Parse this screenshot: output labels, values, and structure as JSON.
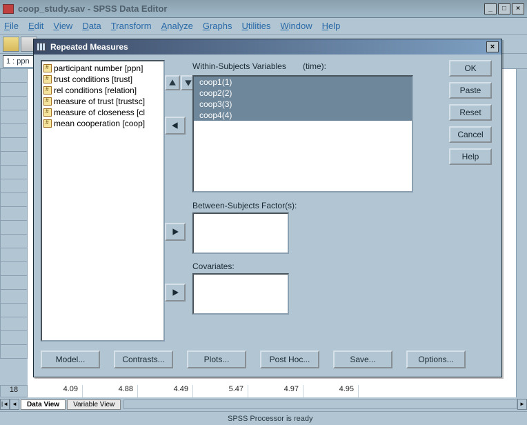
{
  "window": {
    "title": "coop_study.sav - SPSS Data Editor",
    "min_glyph": "_",
    "max_glyph": "□",
    "close_glyph": "×"
  },
  "menu": {
    "file": "File",
    "edit": "Edit",
    "view": "View",
    "data": "Data",
    "transform": "Transform",
    "analyze": "Analyze",
    "graphs": "Graphs",
    "utilities": "Utilities",
    "window": "Window",
    "help": "Help"
  },
  "cellbar": {
    "address": "1 : ppn"
  },
  "grid": {
    "row_number": "18",
    "cells": [
      "4.09",
      "4.88",
      "4.49",
      "5.47",
      "4.97",
      "4.95"
    ]
  },
  "tabs": {
    "data_view": "Data View",
    "variable_view": "Variable View"
  },
  "statusbar": {
    "text": "SPSS Processor  is ready"
  },
  "dialog": {
    "title": "Repeated Measures",
    "close_glyph": "×",
    "labels": {
      "within": "Within-Subjects Variables",
      "factor": "(time):",
      "between": "Between-Subjects Factor(s):",
      "covariates": "Covariates:"
    },
    "variables": [
      "participant number [ppn]",
      "trust conditions [trust]",
      "rel conditions [relation]",
      "measure of trust [trustsc]",
      "measure of closeness [cl",
      "mean cooperation [coop]"
    ],
    "within_subjects": [
      "coop1(1)",
      "coop2(2)",
      "coop3(3)",
      "coop4(4)"
    ],
    "buttons": {
      "ok": "OK",
      "paste": "Paste",
      "reset": "Reset",
      "cancel": "Cancel",
      "help": "Help",
      "model": "Model...",
      "contrasts": "Contrasts...",
      "plots": "Plots...",
      "posthoc": "Post Hoc...",
      "save": "Save...",
      "options": "Options..."
    }
  }
}
